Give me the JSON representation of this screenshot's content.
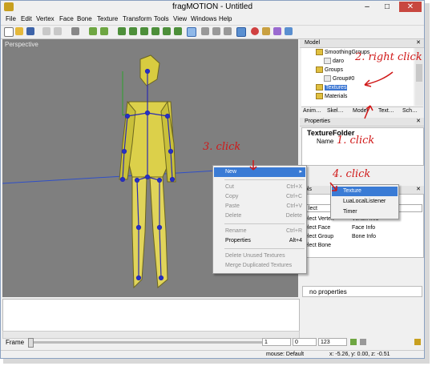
{
  "window": {
    "title": "fragMOTION - Untitled",
    "min": "–",
    "max": "□",
    "close": "✕"
  },
  "menu": [
    "File",
    "Edit",
    "Vertex",
    "Face",
    "Bone",
    "Texture",
    "Transform",
    "Tools",
    "View",
    "Windows",
    "Help"
  ],
  "viewport": {
    "label": "Perspective"
  },
  "model_panel": {
    "title": "Model",
    "close": "✕",
    "nodes": [
      "SmoothingGroups",
      "daro",
      "Groups",
      "Group#0",
      "Textures",
      "Materials"
    ],
    "selected": "Textures"
  },
  "tabs": [
    "Anim…",
    "Skel…",
    "Model",
    "Text…",
    "Sch…"
  ],
  "properties": {
    "title": "Properties",
    "close": "✕",
    "folder": "TextureFolder",
    "row_label": "Name"
  },
  "tools_panel": {
    "title": "ols",
    "close": "✕",
    "combo": "lect",
    "items": [
      {
        "left": "elect Vertex",
        "right": "Vertex Info"
      },
      {
        "left": "elect Face",
        "right": "Face Info"
      },
      {
        "left": "elect Group",
        "right": "Bone Info"
      },
      {
        "left": "elect Bone",
        "right": ""
      }
    ]
  },
  "no_properties": "no properties",
  "context_menu": {
    "new": "New",
    "items": [
      {
        "label": "Cut",
        "shortcut": "Ctrl+X",
        "disabled": true
      },
      {
        "label": "Copy",
        "shortcut": "Ctrl+C",
        "disabled": true
      },
      {
        "label": "Paste",
        "shortcut": "Ctrl+V",
        "disabled": true
      },
      {
        "label": "Delete",
        "shortcut": "Delete",
        "disabled": true
      },
      {
        "label": "Rename",
        "shortcut": "Ctrl+R",
        "disabled": true
      },
      {
        "label": "Properties",
        "shortcut": "Alt+4",
        "disabled": false
      },
      {
        "label": "Delete Unused Textures",
        "shortcut": "",
        "disabled": true
      },
      {
        "label": "Merge Duplicated Textures",
        "shortcut": "",
        "disabled": true
      }
    ]
  },
  "submenu": [
    "Texture",
    "LuaLocalListener",
    "Timer"
  ],
  "frame": {
    "label": "Frame",
    "field1": "1",
    "field2": "0",
    "field3": "123"
  },
  "status": {
    "mode": "mouse: Default",
    "coords": "x: -5.26, y: 0.00, z: -0.51"
  },
  "annotations": [
    "2. right click",
    "1. click",
    "3. click",
    "4. click"
  ],
  "colors": {
    "highlight": "#3a7bd5",
    "annotation": "#d01818",
    "viewport": "#7f7f7f"
  }
}
